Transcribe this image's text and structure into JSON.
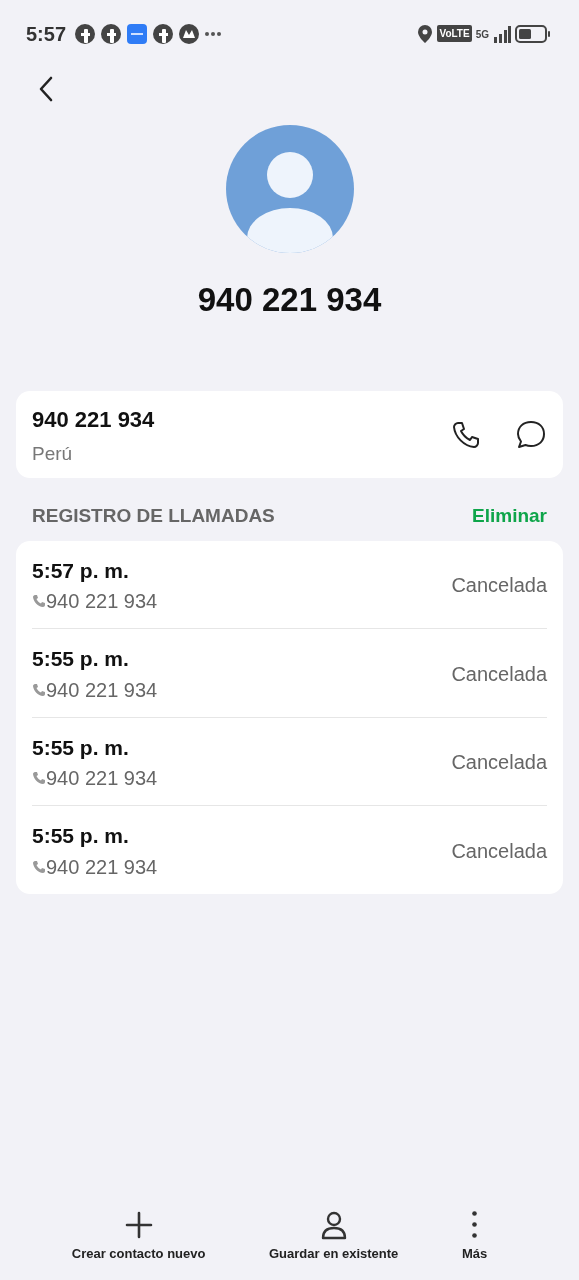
{
  "status_bar": {
    "time": "5:57",
    "notification_icons": [
      {
        "kind": "social"
      },
      {
        "kind": "social"
      },
      {
        "kind": "app"
      },
      {
        "kind": "social"
      },
      {
        "kind": "app2"
      }
    ],
    "volte": "VoLTE",
    "network": "5G"
  },
  "contact": {
    "title": "940 221 934"
  },
  "number_card": {
    "number": "940 221 934",
    "country": "Perú"
  },
  "call_log": {
    "heading": "REGISTRO DE LLAMADAS",
    "action": "Eliminar",
    "entries": [
      {
        "time": "5:57 p. m.",
        "number": "940 221 934",
        "status": "Cancelada"
      },
      {
        "time": "5:55 p. m.",
        "number": "940 221 934",
        "status": "Cancelada"
      },
      {
        "time": "5:55 p. m.",
        "number": "940 221 934",
        "status": "Cancelada"
      },
      {
        "time": "5:55 p. m.",
        "number": "940 221 934",
        "status": "Cancelada"
      }
    ]
  },
  "bottom_actions": [
    {
      "kind": "add",
      "label": "Crear contacto nuevo"
    },
    {
      "kind": "person",
      "label": "Guardar en existente"
    },
    {
      "kind": "more",
      "label": "Más"
    }
  ]
}
